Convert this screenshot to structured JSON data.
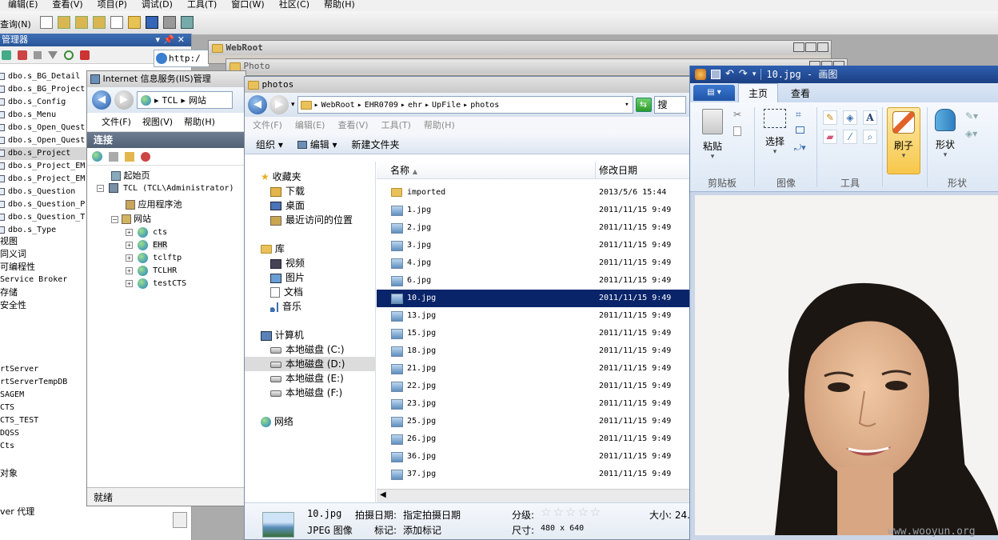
{
  "vs": {
    "menu": [
      "编辑(E)",
      "查看(V)",
      "项目(P)",
      "调试(D)",
      "工具(T)",
      "窗口(W)",
      "社区(C)",
      "帮助(H)"
    ],
    "toolbar_left": "查询(N)",
    "panel_title": "管理器",
    "panel_btns": [
      "▾",
      "📌",
      "✕"
    ],
    "url_fragment": "http:/"
  },
  "object_list": [
    "dbo.s_BG_Detail",
    "dbo.s_BG_Project",
    "dbo.s_Config",
    "dbo.s_Menu",
    "dbo.s_Open_Quest",
    "dbo.s_Open_Quest",
    "dbo.s_Project",
    "dbo.s_Project_EM",
    "dbo.s_Project_EM",
    "dbo.s_Question",
    "dbo.s_Question_P",
    "dbo.s_Question_T",
    "dbo.s_Type"
  ],
  "object_list_selected": 6,
  "misc_nodes": [
    "视图",
    "同义词",
    "可编程性",
    "Service Broker",
    "存储",
    "安全性"
  ],
  "db_nodes": [
    "rtServer",
    "rtServerTempDB",
    "SAGEM",
    "CTS",
    "CTS_TEST",
    "DQSS",
    "Cts"
  ],
  "bottom_nodes": [
    "对象",
    "ver 代理"
  ],
  "bg_windows": {
    "webroot": "WebRoot",
    "photo": "Photo"
  },
  "iis": {
    "title": "Internet 信息服务(IIS)管理",
    "address": [
      "TCL",
      "网站"
    ],
    "menu": [
      "文件(F)",
      "视图(V)",
      "帮助(H)"
    ],
    "connections": "连接",
    "tree": [
      "起始页",
      "TCL (TCL\\Administrator)",
      "应用程序池",
      "网站"
    ],
    "sites": [
      "cts",
      "EHR",
      "tclftp",
      "TCLHR",
      "testCTS"
    ],
    "status": "就绪"
  },
  "explorer": {
    "title": "photos",
    "breadcrumb": [
      "WebRoot",
      "EHR0709",
      "ehr",
      "UpFile",
      "photos"
    ],
    "search": "搜",
    "menu": [
      "文件(F)",
      "编辑(E)",
      "查看(V)",
      "工具(T)",
      "帮助(H)"
    ],
    "commands": [
      "组织",
      "编辑",
      "新建文件夹"
    ],
    "nav": {
      "favorites": "收藏夹",
      "fav_items": [
        "下载",
        "桌面",
        "最近访问的位置"
      ],
      "library": "库",
      "lib_items": [
        "视频",
        "图片",
        "文档",
        "音乐"
      ],
      "computer": "计算机",
      "drives": [
        "本地磁盘 (C:)",
        "本地磁盘 (D:)",
        "本地磁盘 (E:)",
        "本地磁盘 (F:)"
      ],
      "selected_drive": 1,
      "network": "网络"
    },
    "columns": [
      "名称",
      "修改日期"
    ],
    "files": [
      {
        "name": "imported",
        "date": "2013/5/6 15:44",
        "folder": true
      },
      {
        "name": "1.jpg",
        "date": "2011/11/15 9:49"
      },
      {
        "name": "2.jpg",
        "date": "2011/11/15 9:49"
      },
      {
        "name": "3.jpg",
        "date": "2011/11/15 9:49"
      },
      {
        "name": "4.jpg",
        "date": "2011/11/15 9:49"
      },
      {
        "name": "6.jpg",
        "date": "2011/11/15 9:49"
      },
      {
        "name": "10.jpg",
        "date": "2011/11/15 9:49",
        "selected": true
      },
      {
        "name": "13.jpg",
        "date": "2011/11/15 9:49"
      },
      {
        "name": "15.jpg",
        "date": "2011/11/15 9:49"
      },
      {
        "name": "18.jpg",
        "date": "2011/11/15 9:49"
      },
      {
        "name": "21.jpg",
        "date": "2011/11/15 9:49"
      },
      {
        "name": "22.jpg",
        "date": "2011/11/15 9:49"
      },
      {
        "name": "23.jpg",
        "date": "2011/11/15 9:49"
      },
      {
        "name": "25.jpg",
        "date": "2011/11/15 9:49"
      },
      {
        "name": "26.jpg",
        "date": "2011/11/15 9:49"
      },
      {
        "name": "36.jpg",
        "date": "2011/11/15 9:49"
      },
      {
        "name": "37.jpg",
        "date": "2011/11/15 9:49"
      }
    ],
    "details": {
      "filename": "10.jpg",
      "type": "JPEG 图像",
      "date_label": "拍摄日期:",
      "date_value": "指定拍摄日期",
      "tag_label": "标记:",
      "tag_value": "添加标记",
      "rating_label": "分级:",
      "size_label": "尺寸:",
      "size_value": "480 x 640",
      "filesize_label": "大小: 24."
    }
  },
  "paint": {
    "title": "10.jpg - 画图",
    "tabs": [
      "主页",
      "查看"
    ],
    "groups": [
      "剪贴板",
      "图像",
      "工具",
      "形状"
    ],
    "buttons": {
      "paste": "粘贴",
      "select": "选择",
      "brush": "刷子",
      "shapes": "形状"
    }
  },
  "watermark": "www.wooyun.org",
  "colors": {
    "selection": "#0a246a",
    "ribbon_tab": "#2b68c2"
  }
}
